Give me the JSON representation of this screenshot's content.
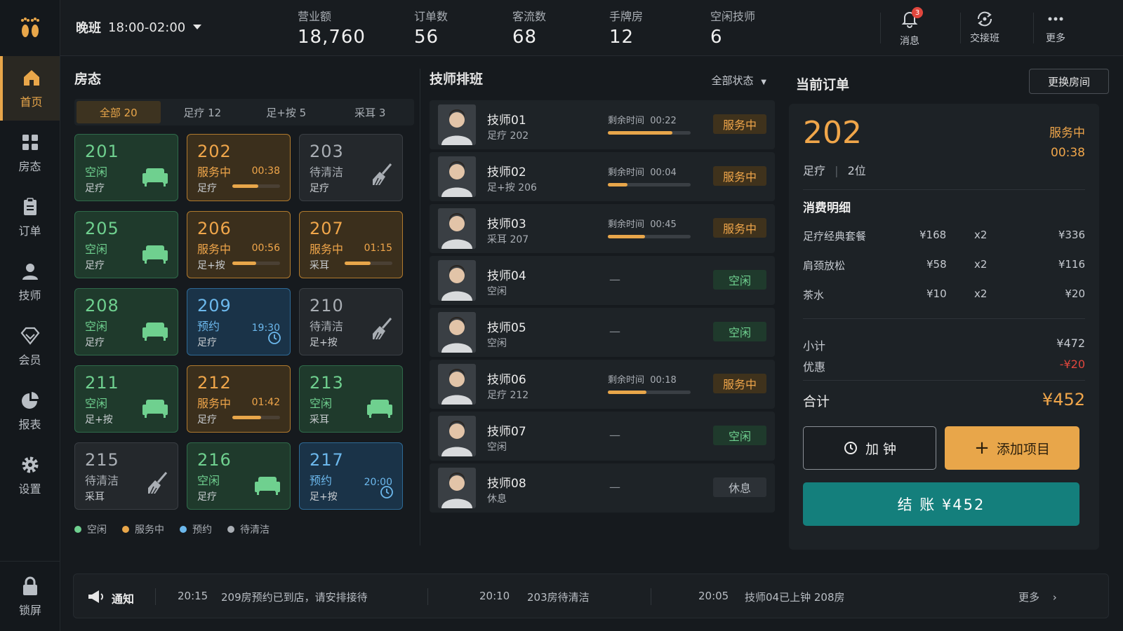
{
  "topbar": {
    "shift_name": "晚班",
    "shift_time": "18:00-02:00",
    "stats": [
      {
        "label": "营业额",
        "value": "18,760"
      },
      {
        "label": "订单数",
        "value": "56"
      },
      {
        "label": "客流数",
        "value": "68"
      },
      {
        "label": "手牌房",
        "value": "12"
      },
      {
        "label": "空闲技师",
        "value": "6"
      }
    ],
    "messages_label": "消息",
    "messages_badge": "3",
    "handover_label": "交接班",
    "more_label": "更多"
  },
  "sidebar": {
    "items": [
      {
        "label": "首页",
        "icon": "home-icon"
      },
      {
        "label": "房态",
        "icon": "grid-icon"
      },
      {
        "label": "订单",
        "icon": "clipboard-icon"
      },
      {
        "label": "技师",
        "icon": "person-icon"
      },
      {
        "label": "会员",
        "icon": "diamond-icon"
      },
      {
        "label": "报表",
        "icon": "pie-chart-icon"
      },
      {
        "label": "设置",
        "icon": "gear-icon"
      }
    ],
    "lock_label": "锁屏"
  },
  "rooms": {
    "title": "房态",
    "tabs": [
      "全部 20",
      "足疗 12",
      "足+按 5",
      "采耳 3"
    ],
    "list": [
      {
        "num": "201",
        "status": "空闲",
        "type": "足疗",
        "time": "",
        "progress": null
      },
      {
        "num": "202",
        "status": "服务中",
        "type": "足疗",
        "time": "00:38",
        "progress": 0.55
      },
      {
        "num": "203",
        "status": "待清洁",
        "type": "足疗",
        "time": "",
        "progress": null
      },
      {
        "num": "205",
        "status": "空闲",
        "type": "足疗",
        "time": "",
        "progress": null
      },
      {
        "num": "206",
        "status": "服务中",
        "type": "足+按",
        "time": "00:56",
        "progress": 0.5
      },
      {
        "num": "207",
        "status": "服务中",
        "type": "采耳",
        "time": "01:15",
        "progress": 0.55
      },
      {
        "num": "208",
        "status": "空闲",
        "type": "足疗",
        "time": "",
        "progress": null
      },
      {
        "num": "209",
        "status": "预约",
        "type": "足疗",
        "time": "19:30",
        "progress": null
      },
      {
        "num": "210",
        "status": "待清洁",
        "type": "足+按",
        "time": "",
        "progress": null
      },
      {
        "num": "211",
        "status": "空闲",
        "type": "足+按",
        "time": "",
        "progress": null
      },
      {
        "num": "212",
        "status": "服务中",
        "type": "足疗",
        "time": "01:42",
        "progress": 0.6
      },
      {
        "num": "213",
        "status": "空闲",
        "type": "采耳",
        "time": "",
        "progress": null
      },
      {
        "num": "215",
        "status": "待清洁",
        "type": "采耳",
        "time": "",
        "progress": null
      },
      {
        "num": "216",
        "status": "空闲",
        "type": "足疗",
        "time": "",
        "progress": null
      },
      {
        "num": "217",
        "status": "预约",
        "type": "足+按",
        "time": "20:00",
        "progress": null
      }
    ],
    "legend": [
      "空闲",
      "服务中",
      "预约",
      "待清洁"
    ]
  },
  "techs": {
    "title": "技师排班",
    "filter": "全部状态",
    "remain_label": "剩余时间",
    "list": [
      {
        "name": "技师01",
        "sub": "足疗 202",
        "remain": "00:22",
        "progress": 0.78,
        "status": "服务中"
      },
      {
        "name": "技师02",
        "sub": "足+按 206",
        "remain": "00:04",
        "progress": 0.24,
        "status": "服务中"
      },
      {
        "name": "技师03",
        "sub": "采耳 207",
        "remain": "00:45",
        "progress": 0.45,
        "status": "服务中"
      },
      {
        "name": "技师04",
        "sub": "空闲",
        "remain": "",
        "progress": null,
        "status": "空闲"
      },
      {
        "name": "技师05",
        "sub": "空闲",
        "remain": "",
        "progress": null,
        "status": "空闲"
      },
      {
        "name": "技师06",
        "sub": "足疗 212",
        "remain": "00:18",
        "progress": 0.47,
        "status": "服务中"
      },
      {
        "name": "技师07",
        "sub": "空闲",
        "remain": "",
        "progress": null,
        "status": "空闲"
      },
      {
        "name": "技师08",
        "sub": "休息",
        "remain": "",
        "progress": null,
        "status": "休息"
      }
    ]
  },
  "order": {
    "title": "当前订单",
    "swap_label": "更换房间",
    "room": "202",
    "type": "足疗",
    "guests": "2位",
    "status": "服务中",
    "time": "00:38",
    "section_label": "消费明细",
    "items": [
      {
        "name": "足疗经典套餐",
        "price": "¥168",
        "qty": "x2",
        "amount": "¥336"
      },
      {
        "name": "肩颈放松",
        "price": "¥58",
        "qty": "x2",
        "amount": "¥116"
      },
      {
        "name": "茶水",
        "price": "¥10",
        "qty": "x2",
        "amount": "¥20"
      }
    ],
    "subtotal_label": "小计",
    "subtotal": "¥472",
    "discount_label": "优惠",
    "discount": "-¥20",
    "total_label": "合计",
    "total": "¥452",
    "extend_label": "加 钟",
    "add_item_label": "添加项目",
    "checkout_label": "结 账 ¥452"
  },
  "notice": {
    "label": "通知",
    "entries": [
      {
        "time": "20:15",
        "text": "209房预约已到店，请安排接待"
      },
      {
        "time": "20:10",
        "text": "203房待清洁"
      },
      {
        "time": "20:05",
        "text": "技师04已上钟 208房"
      }
    ],
    "more_label": "更多"
  },
  "colors": {
    "accent": "#e8a64a",
    "free": "#6fd08f",
    "booked": "#6cb8ec",
    "cleaning": "#a9aeb4",
    "checkout": "#147f7c",
    "discount": "#e0463d"
  }
}
